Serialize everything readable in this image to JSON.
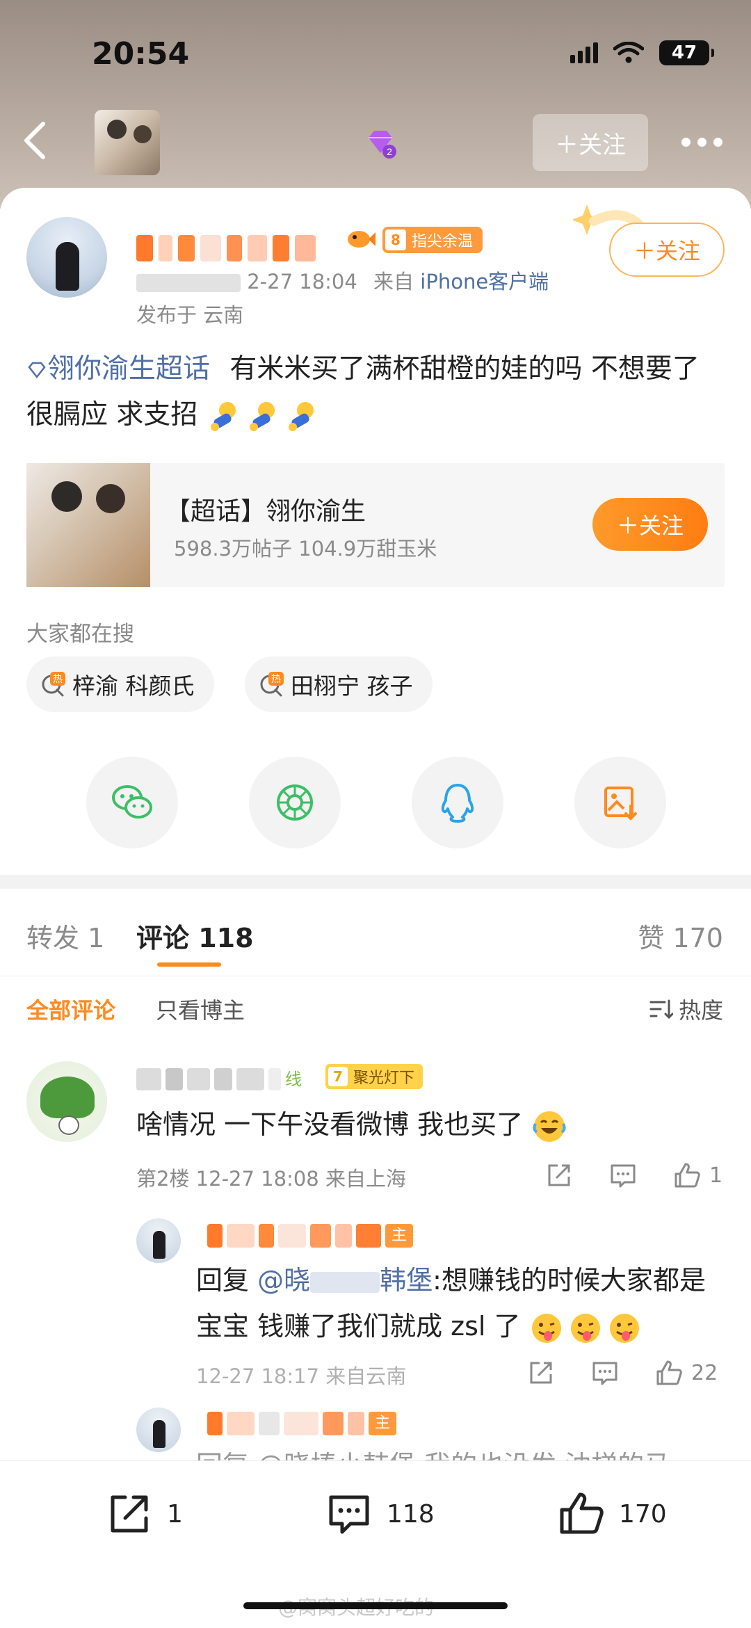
{
  "status": {
    "time": "20:54",
    "battery": "47"
  },
  "nav": {
    "follow_label": "＋关注",
    "gem_level": "2"
  },
  "post": {
    "level": "8",
    "level_label": "指尖余温",
    "time_suffix": "2-27 18:04",
    "source_prefix": "来自",
    "source": "iPhone客户端",
    "location": "发布于 云南",
    "follow_label": "＋关注",
    "topic": "翎你渝生超话",
    "body": "有米米买了满杯甜橙的娃的吗 不想要了 很膈应 求支招"
  },
  "topic_card": {
    "title": "【超话】翎你渝生",
    "stats": "598.3万帖子 104.9万甜玉米",
    "follow_label": "＋关注"
  },
  "search": {
    "title": "大家都在搜",
    "chips": [
      {
        "badge": "热",
        "text": "梓渝 科颜氏"
      },
      {
        "badge": "热",
        "text": "田栩宁 孩子"
      }
    ]
  },
  "tabs": {
    "repost": "转发 1",
    "comment": "评论 118",
    "like": "赞 170"
  },
  "filter": {
    "all": "全部评论",
    "owner_only": "只看博主",
    "sort": "热度"
  },
  "comments": [
    {
      "name_tail": "线",
      "level": "7",
      "badge": "聚光灯下",
      "text": "啥情况 一下午没看微博 我也买了",
      "meta": "第2楼 12-27 18:08 来自上海",
      "likes": "1"
    }
  ],
  "replies": [
    {
      "badge_tail": "主",
      "reply_prefix": "回复",
      "mention_start": "@晓",
      "mention_end": "韩堡",
      "text": ":想赚钱的时候大家都是宝宝 钱赚了我们就成 zsl 了",
      "meta": "12-27 18:17 来自云南",
      "likes": "22"
    },
    {
      "badge_tail": "主",
      "text": "回复 @晓棒小韩堡 我的也没发 油梯的马"
    }
  ],
  "bottom_bar": {
    "repost_count": "1",
    "comment_count": "118",
    "like_count": "170"
  },
  "watermark": "@窝窝头超好吃的"
}
